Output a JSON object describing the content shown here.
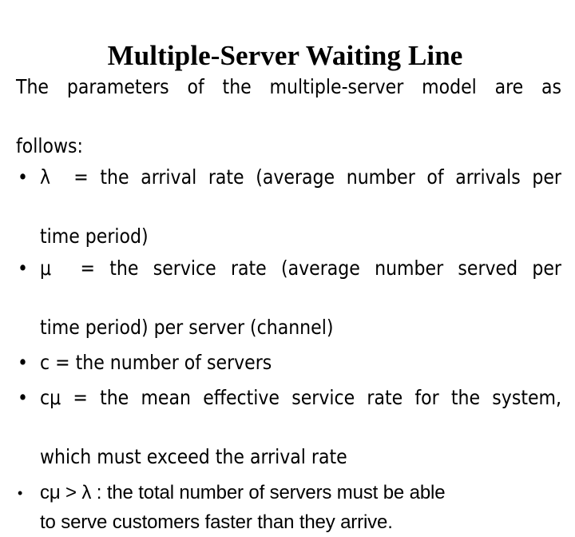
{
  "slide": {
    "title": "Multiple-Server Waiting Line",
    "intro": {
      "line1": "The parameters of the multiple-server model are as",
      "line2": "follows:"
    },
    "bullet_marker": "•",
    "bullets": [
      {
        "marker": "•",
        "symbol": "λ  = ",
        "line1": "the arrival rate (average number of arrivals per",
        "line2": "time period)",
        "full_text": "λ = the arrival rate (average number of arrivals per time period)"
      },
      {
        "marker": "•",
        "symbol": "μ  = ",
        "line1": "the service rate (average number served per",
        "line2": "time period) per server (channel)",
        "full_text": "μ = the service rate (average number served per time period) per server (channel)"
      },
      {
        "marker": "•",
        "symbol": "c = ",
        "line1": "the number of servers",
        "line2": "",
        "full_text": "c = the number of servers"
      },
      {
        "marker": "•",
        "symbol": "cμ = ",
        "line1": "the mean effective service rate for the system,",
        "line2": "which must exceed the arrival rate",
        "full_text": "cμ = the mean effective service rate for the system, which must exceed the arrival rate"
      },
      {
        "marker": "•",
        "symbol": "cμ > λ : ",
        "line1": "the total number of servers must be able",
        "line2": "to serve customers faster than they arrive.",
        "full_text": "cμ > λ : the total number of servers must be able to serve customers faster than they arrive."
      }
    ]
  },
  "colors": {
    "background": "#ffffff",
    "text": "#000000"
  }
}
